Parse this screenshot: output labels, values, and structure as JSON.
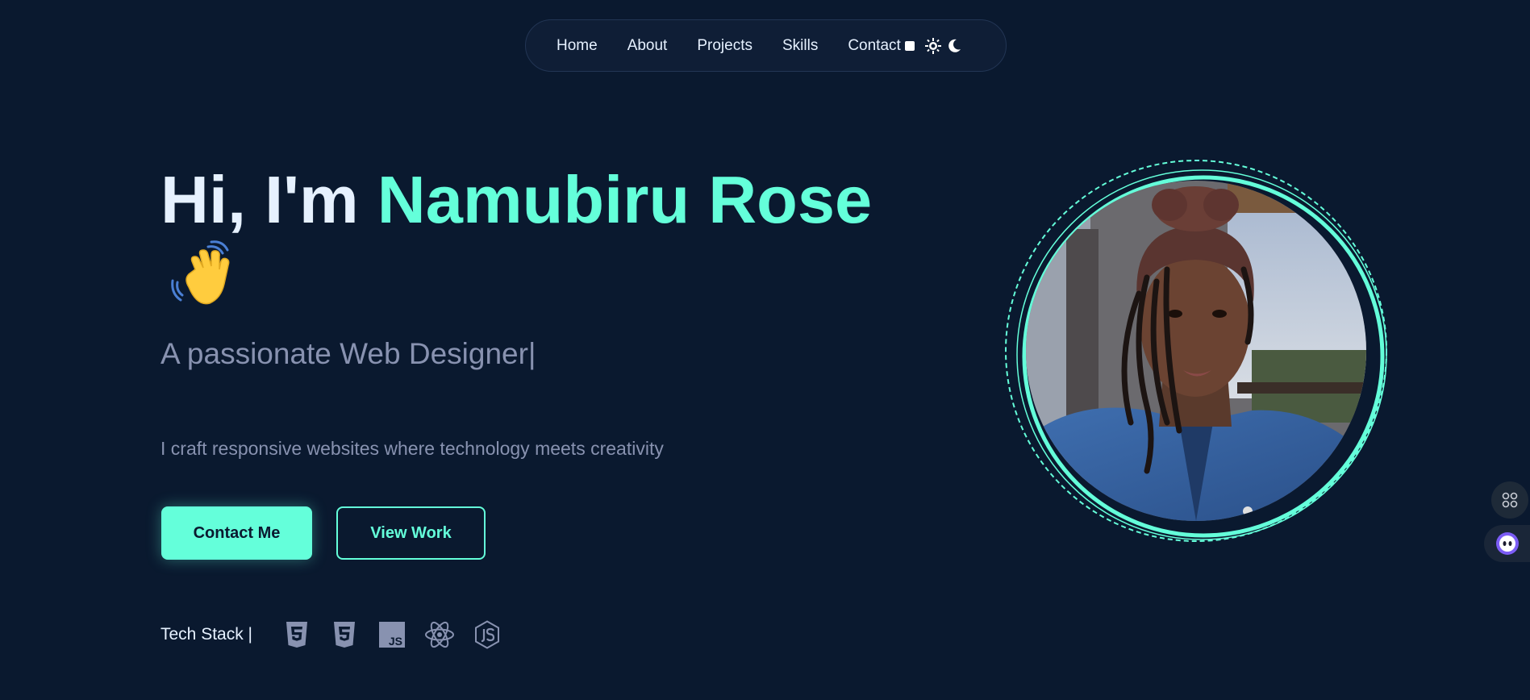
{
  "nav": {
    "items": [
      "Home",
      "About",
      "Projects",
      "Skills",
      "Contact"
    ],
    "theme_icons": [
      "checkbox-icon",
      "sun-icon",
      "moon-icon"
    ]
  },
  "hero": {
    "greeting": "Hi, I'm ",
    "name": "Namubiru Rose",
    "emoji": "waving-hand-icon",
    "subtitle": "A passionate Web Designer|",
    "tagline": "I craft responsive websites where technology meets creativity"
  },
  "buttons": {
    "primary": "Contact Me",
    "secondary": "View Work"
  },
  "tech_stack": {
    "label": "Tech Stack |",
    "icons": [
      "html5-icon",
      "css3-icon",
      "javascript-icon",
      "react-icon",
      "nodejs-icon"
    ]
  },
  "floating": {
    "icons": [
      "apps-grid-icon",
      "assistant-bot-icon"
    ]
  },
  "colors": {
    "background": "#0a192f",
    "accent": "#64ffda",
    "text_primary": "#e6f1ff",
    "text_secondary": "#8892b0"
  }
}
